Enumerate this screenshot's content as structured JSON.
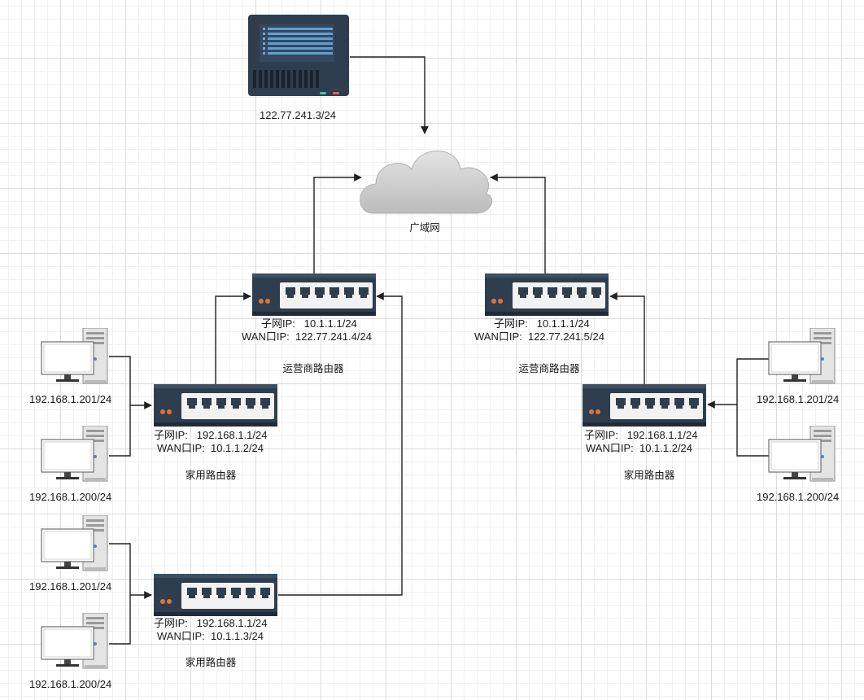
{
  "server": {
    "ip": "122.77.241.3/24"
  },
  "wan": {
    "label": "广域网"
  },
  "carrier_left": {
    "subnet": "子网IP:   10.1.1.1/24",
    "wan": "WAN口IP:  122.77.241.4/24",
    "title": "运营商路由器"
  },
  "carrier_right": {
    "subnet": "子网IP:   10.1.1.1/24",
    "wan": "WAN口IP:  122.77.241.5/24",
    "title": "运营商路由器"
  },
  "home_left_top": {
    "subnet": "子网IP:   192.168.1.1/24",
    "wan": "WAN口IP:  10.1.1.2/24",
    "title": "家用路由器",
    "pc1": "192.168.1.201/24",
    "pc2": "192.168.1.200/24"
  },
  "home_left_bottom": {
    "subnet": "子网IP:   192.168.1.1/24",
    "wan": "WAN口IP:  10.1.1.3/24",
    "title": "家用路由器",
    "pc1": "192.168.1.201/24",
    "pc2": "192.168.1.200/24"
  },
  "home_right": {
    "subnet": "子网IP:   192.168.1.1/24",
    "wan": "WAN口IP:  10.1.1.2/24",
    "title": "家用路由器",
    "pc1": "192.168.1.201/24",
    "pc2": "192.168.1.200/24"
  },
  "colors": {
    "device_body": "#2e3e4e",
    "port_panel": "#f2f2f2",
    "led": "#e0733a",
    "cloud": "#cfcfcf",
    "connector": "#222222"
  }
}
